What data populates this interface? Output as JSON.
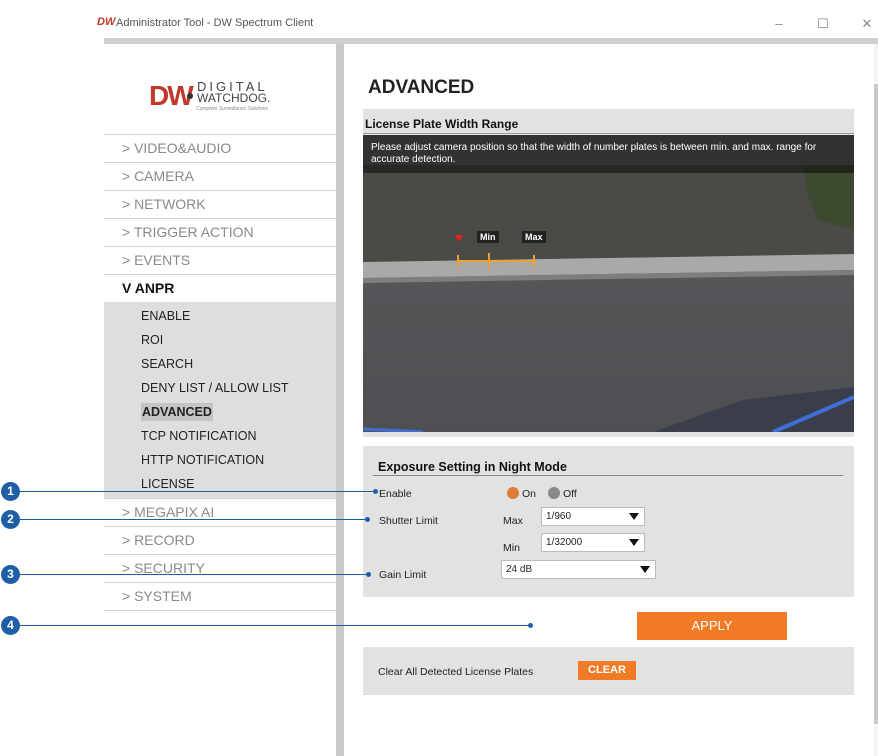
{
  "window": {
    "logo": "DW",
    "title": "Administrator Tool - DW Spectrum Client",
    "minimize": "–",
    "maximize": "☐",
    "close": "✕"
  },
  "brand": {
    "dw": "DW",
    "line1": "DIGITAL",
    "line2": "WATCHDOG.",
    "tagline": "Complete Surveillance Solutions"
  },
  "nav": {
    "video_audio": "> VIDEO&AUDIO",
    "camera": "> CAMERA",
    "network": "> NETWORK",
    "trigger_action": "> TRIGGER ACTION",
    "events": "> EVENTS",
    "anpr": "V ANPR",
    "anpr_sub": [
      "ENABLE",
      "ROI",
      "SEARCH",
      "DENY LIST / ALLOW LIST",
      "ADVANCED",
      "TCP NOTIFICATION",
      "HTTP NOTIFICATION",
      "LICENSE"
    ],
    "megapix_ai": "> MEGAPIX AI",
    "record": "> RECORD",
    "security": "> SECURITY",
    "system": "> SYSTEM"
  },
  "main": {
    "page_title": "ADVANCED",
    "plate_width": {
      "title": "License Plate Width Range",
      "notice": "Please adjust camera position so that the width of number plates is between min. and max. range for accurate detection.",
      "min_label": "Min",
      "max_label": "Max"
    },
    "exposure": {
      "title": "Exposure Setting in Night Mode",
      "enable_label": "Enable",
      "on_label": "On",
      "off_label": "Off",
      "shutter_label": "Shutter Limit",
      "max_label": "Max",
      "min_label": "Min",
      "shutter_max": "1/960",
      "shutter_min": "1/32000",
      "gain_label": "Gain Limit",
      "gain_value": "24 dB"
    },
    "apply_label": "APPLY",
    "clear_section": {
      "label": "Clear All Detected License Plates",
      "button": "CLEAR"
    }
  },
  "callouts": [
    "1",
    "2",
    "3",
    "4"
  ],
  "colors": {
    "accent": "#f07a26",
    "callout": "#1f5fa8",
    "radio_on": "#e07b39",
    "radio_off": "#888888"
  }
}
